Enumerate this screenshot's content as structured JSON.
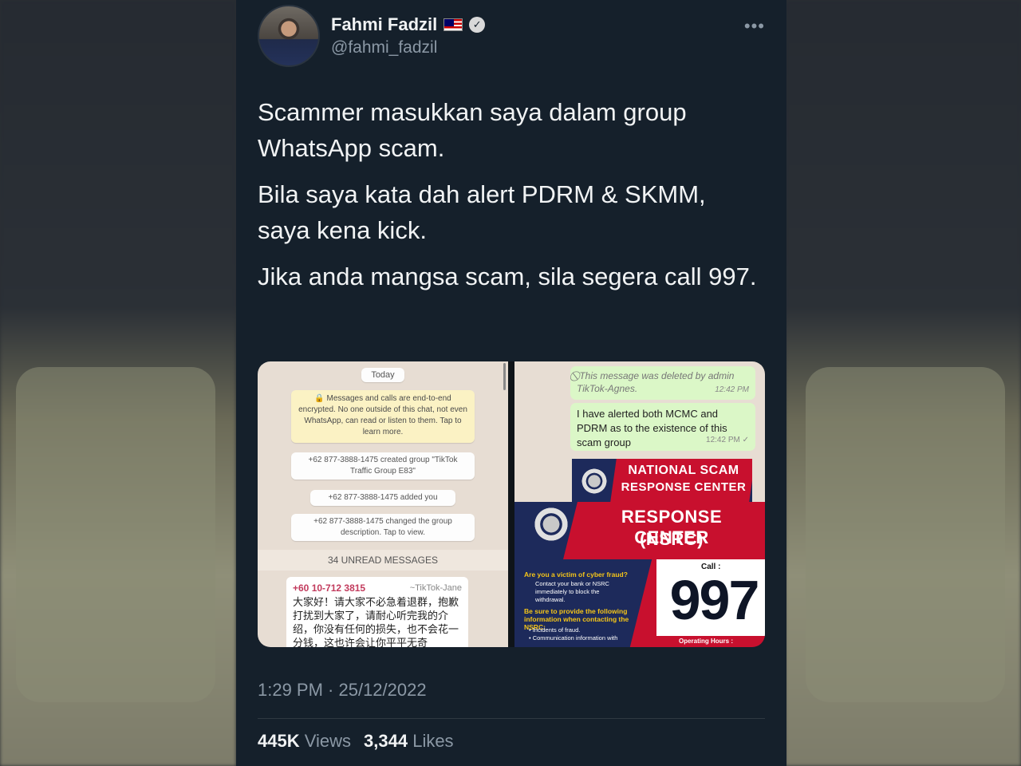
{
  "author": {
    "name": "Fahmi Fadzil",
    "handle": "@fahmi_fadzil",
    "flag_icon": "malaysia-flag-icon",
    "verified_icon": "verified-badge-icon"
  },
  "more_icon": "more-horizontal-icon",
  "tweet_paragraphs": [
    "Scammer masukkan saya dalam group WhatsApp scam.",
    "Bila saya kata dah alert PDRM & SKMM, saya kena kick.",
    "Jika anda mangsa scam, sila segera call 997."
  ],
  "media_left": {
    "date_pill": "Today",
    "encryption_notice": "🔒 Messages and calls are end-to-end encrypted. No one outside of this chat, not even WhatsApp, can read or listen to them. Tap to learn more.",
    "system_messages": [
      "+62 877-3888-1475 created group \"TikTok Traffic Group E83\"",
      "+62 877-3888-1475 added you",
      "+62 877-3888-1475 changed the group description. Tap to view."
    ],
    "unread_banner": "34 UNREAD MESSAGES",
    "message": {
      "sender": "+60 10-712 3815",
      "alias": "~TikTok-Jane",
      "text": "大家好！请大家不必急着退群，抱歉打扰到大家了，请耐心听完我的介绍，你没有任何的损失，也不会花一分钱，这也许会让你平平无奇"
    }
  },
  "media_right_top": {
    "deleted_text": "⃠ This message was deleted by admin TikTok-Agnes.",
    "deleted_time": "12:42 PM",
    "message_text": "I have alerted both MCMC and PDRM as to the existence of this scam group",
    "message_time": "12:42 PM ✓",
    "banner_line1": "NATIONAL SCAM",
    "banner_line2": "RESPONSE CENTER"
  },
  "media_right_bottom": {
    "title_line1": "RESPONSE CENTER",
    "title_line2": "(NSRC)",
    "question": "Are you a victim of cyber fraud?",
    "instruction": "Contact your bank or NSRC immediately to block the withdrawal.",
    "provide_info": "Be sure to provide the following information when contacting the NSRC:",
    "bullets": [
      "Incidents of fraud.",
      "Communication information with"
    ],
    "call_label": "Call :",
    "call_number": "997",
    "operating_hours": "Operating Hours :"
  },
  "timestamp": "1:29 PM · 25/12/2022",
  "stats": {
    "views_count": "445K",
    "views_label": "Views",
    "likes_count": "3,344",
    "likes_label": "Likes"
  }
}
